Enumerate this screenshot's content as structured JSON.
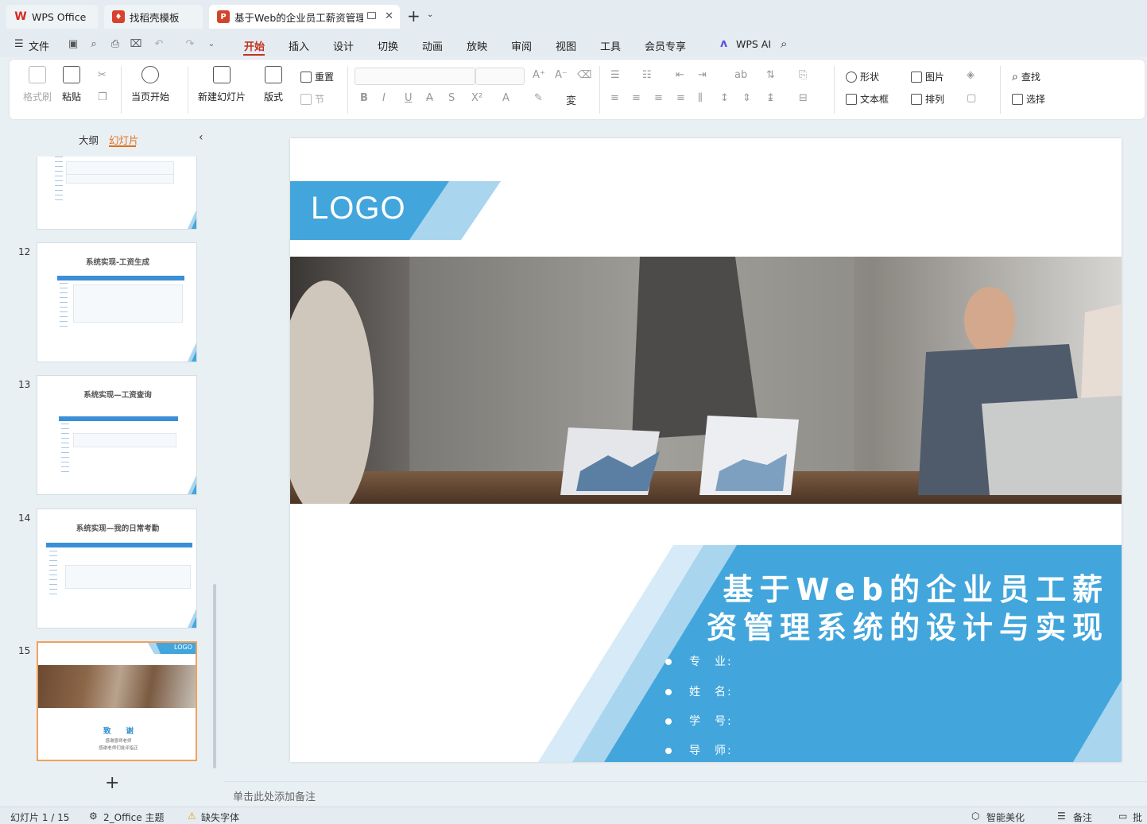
{
  "tabs": {
    "wps": "WPS Office",
    "template": "找稻壳模板",
    "doc": "基于Web的企业员工薪资管理"
  },
  "menu": {
    "file": "文件",
    "items": [
      "开始",
      "插入",
      "设计",
      "切换",
      "动画",
      "放映",
      "审阅",
      "视图",
      "工具",
      "会员专享"
    ],
    "wps_ai": "WPS AI"
  },
  "ribbon": {
    "format_painter": "格式刷",
    "paste": "粘贴",
    "from_current": "当页开始",
    "new_slide": "新建幻灯片",
    "layout": "版式",
    "reset": "重置",
    "section": "节",
    "shape": "形状",
    "picture": "图片",
    "find": "查找",
    "textbox": "文本框",
    "arrange": "排列",
    "select": "选择"
  },
  "panel": {
    "outline_tab": "大纲",
    "slides_tab": "幻灯片",
    "thumbs": [
      {
        "num": "12",
        "title": "系统实现-工资生成"
      },
      {
        "num": "13",
        "title": "系统实现—工资查询"
      },
      {
        "num": "14",
        "title": "系统实现—我的日常考勤"
      },
      {
        "num": "15",
        "logo": "LOGO",
        "title": "致　　谢",
        "line1": "感谢恩师老师",
        "line2": "感谢老师们批评指正"
      }
    ]
  },
  "slide": {
    "logo": "LOGO",
    "title_line1": "基于Web的企业员工薪",
    "title_line2": "资管理系统的设计与实现",
    "fields": [
      "专　业:",
      "姓　名:",
      "学　号:",
      "导　师:"
    ]
  },
  "notes_placeholder": "单击此处添加备注",
  "status": {
    "slide_count": "幻灯片 1 / 15",
    "theme": "2_Office 主题",
    "missing_font": "缺失字体",
    "beautify": "智能美化",
    "notes": "备注",
    "comment": "批注"
  },
  "colors": {
    "accent_blue": "#42a6dc",
    "light_blue": "#a9d5ef",
    "active_menu": "#c3321f",
    "active_panel_tab": "#e0701b"
  }
}
